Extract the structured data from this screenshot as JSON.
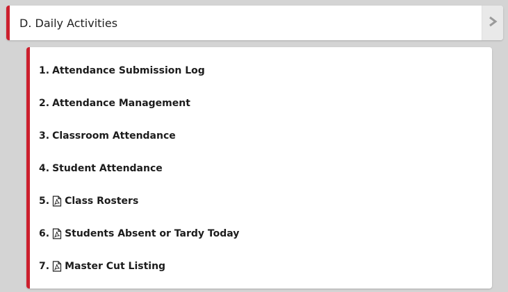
{
  "section": {
    "title": "D. Daily Activities",
    "icon": "chevron-right-icon",
    "accent_color": "#cc1f2d"
  },
  "items": [
    {
      "number": "1.",
      "label": "Attendance Submission Log",
      "icon": null
    },
    {
      "number": "2.",
      "label": "Attendance Management",
      "icon": null
    },
    {
      "number": "3.",
      "label": "Classroom Attendance",
      "icon": null
    },
    {
      "number": "4.",
      "label": "Student Attendance",
      "icon": null
    },
    {
      "number": "5.",
      "label": "Class Rosters",
      "icon": "pdf-icon"
    },
    {
      "number": "6.",
      "label": "Students Absent or Tardy Today",
      "icon": "pdf-icon"
    },
    {
      "number": "7.",
      "label": "Master Cut Listing",
      "icon": "pdf-icon"
    }
  ]
}
